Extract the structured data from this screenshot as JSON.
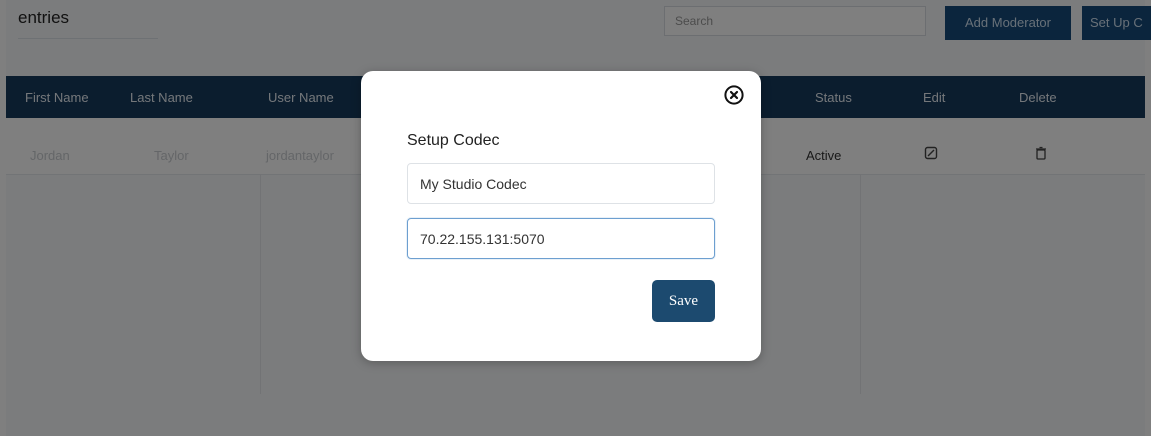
{
  "background": {
    "entries_label": "entries",
    "search_placeholder": "Search",
    "buttons": {
      "add": "Add Moderator",
      "setup": "Set Up C"
    },
    "table": {
      "headers": [
        "First Name",
        "Last Name",
        "User Name",
        "Status",
        "Edit",
        "Delete"
      ],
      "row": {
        "first_name": "Jordan",
        "last_name": "Taylor",
        "user_name": "jordantaylor",
        "status": "Active"
      }
    }
  },
  "modal": {
    "title": "Setup Codec",
    "name_value": "My Studio Codec",
    "address_value": "70.22.155.131:5070",
    "save_label": "Save",
    "close_icon": "close-circle-icon"
  },
  "colors": {
    "primary": "#1c4a6f",
    "header": "#163a5c",
    "focus_border": "#6d9fd0"
  }
}
